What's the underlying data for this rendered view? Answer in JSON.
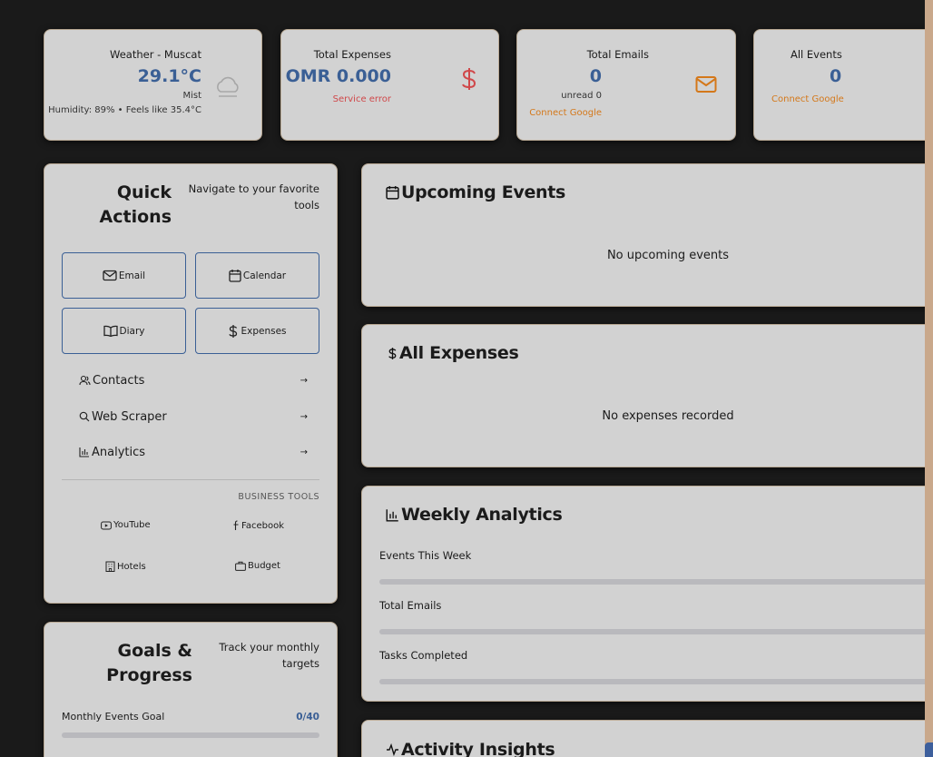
{
  "stats": {
    "weather": {
      "title": "Weather - Muscat",
      "value": "29.1°C",
      "condition": "Mist",
      "details": "Humidity: 89% • Feels like 35.4°C",
      "icon": "cloud-icon"
    },
    "expenses": {
      "title": "Total Expenses",
      "value": "OMR 0.000",
      "error": "Service error",
      "icon": "dollar-icon"
    },
    "emails": {
      "title": "Total Emails",
      "value": "0",
      "sub": "unread 0",
      "link": "Connect Google",
      "icon": "mail-icon"
    },
    "events": {
      "title": "All Events",
      "value": "0",
      "link": "Connect Google"
    }
  },
  "quick_actions": {
    "title_line1": "Quick",
    "title_line2": "Actions",
    "desc_line1": "Navigate to your favorite",
    "desc_line2": "tools",
    "buttons": [
      {
        "label": "Email",
        "icon": "mail-icon"
      },
      {
        "label": "Calendar",
        "icon": "calendar-icon"
      },
      {
        "label": "Diary",
        "icon": "book-icon"
      },
      {
        "label": "Expenses",
        "icon": "dollar-icon"
      }
    ],
    "links": [
      {
        "label": "Contacts",
        "icon": "users-icon",
        "arrow": "→"
      },
      {
        "label": "Web Scraper",
        "icon": "search-icon",
        "arrow": "→"
      },
      {
        "label": "Analytics",
        "icon": "bar-chart-icon",
        "arrow": "→"
      }
    ],
    "business_label": "BUSINESS TOOLS",
    "business": [
      {
        "label": "YouTube",
        "icon": "youtube-icon"
      },
      {
        "label": "Facebook",
        "icon": "facebook-icon"
      },
      {
        "label": "Hotels",
        "icon": "building-icon"
      },
      {
        "label": "Budget",
        "icon": "briefcase-icon"
      }
    ]
  },
  "goals": {
    "title_line1": "Goals &",
    "title_line2": "Progress",
    "desc_line1": "Track your monthly",
    "desc_line2": "targets",
    "items": [
      {
        "label": "Monthly Events Goal",
        "value": "0/40",
        "progress": 0
      }
    ]
  },
  "upcoming": {
    "title": "Upcoming Events",
    "empty": "No upcoming events",
    "icon": "calendar-icon"
  },
  "all_expenses": {
    "title": "All Expenses",
    "empty": "No expenses recorded",
    "icon": "dollar-icon"
  },
  "weekly": {
    "title": "Weekly Analytics",
    "icon": "bar-chart-icon",
    "items": [
      {
        "label": "Events This Week",
        "progress": 0
      },
      {
        "label": "Total Emails",
        "progress": 0
      },
      {
        "label": "Tasks Completed",
        "progress": 0
      }
    ]
  },
  "activity": {
    "title": "Activity Insights",
    "icon": "activity-icon"
  },
  "colors": {
    "background": "#1a1a1a",
    "card": "#d2d2d2",
    "accent": "#3a5f95",
    "warning": "#d4781a",
    "error": "#d0484a"
  }
}
